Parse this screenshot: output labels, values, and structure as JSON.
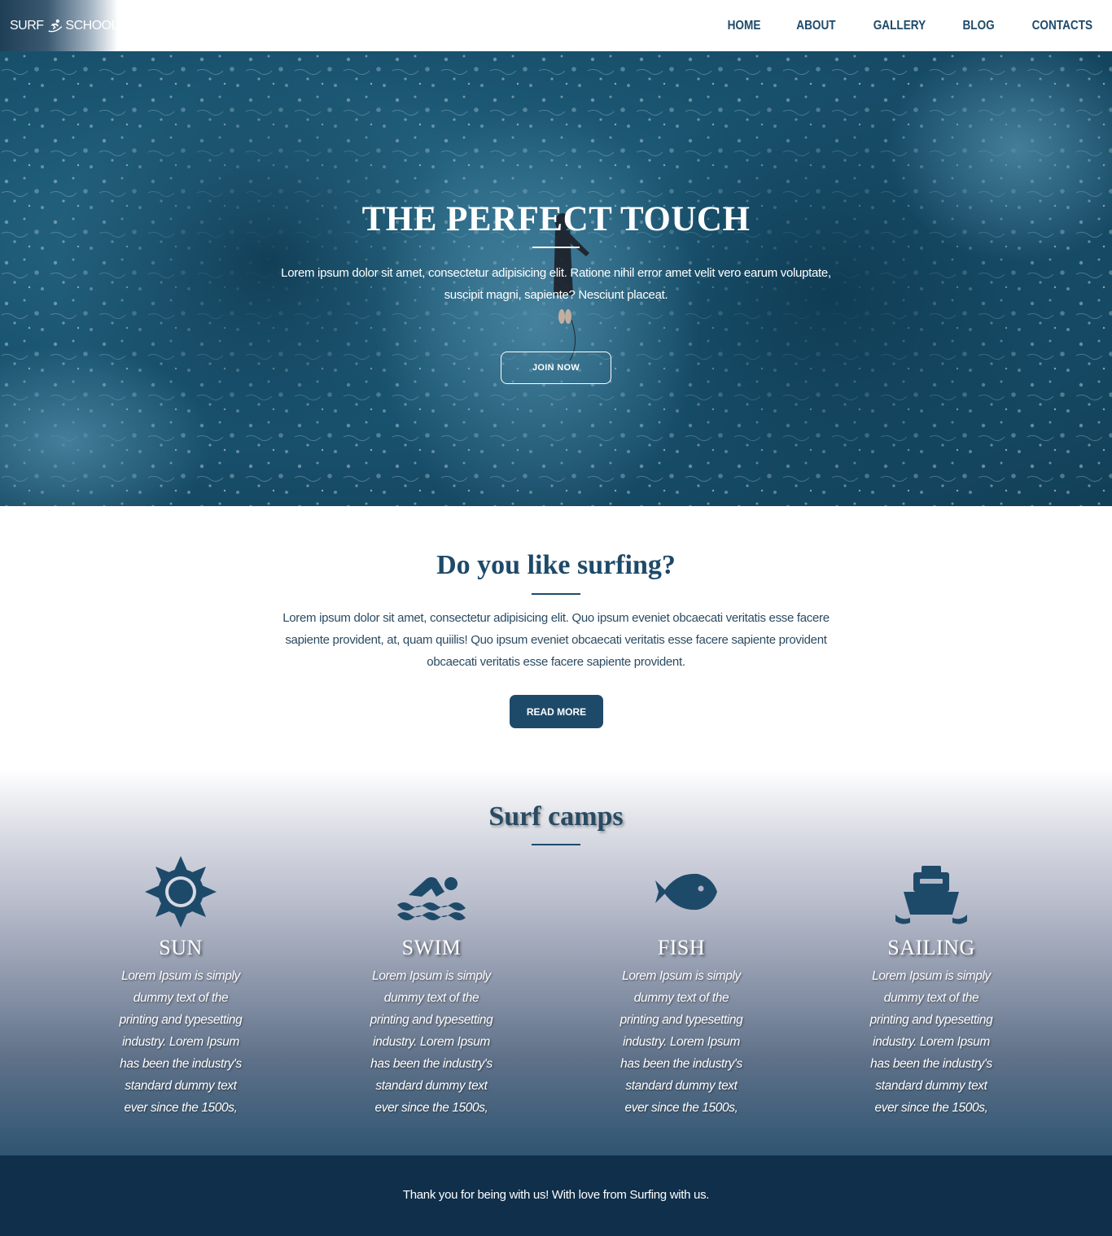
{
  "header": {
    "logo": {
      "left_text": "SURF",
      "right_text": "SCHOOL",
      "icon": "surfer-icon"
    },
    "nav": [
      {
        "label": "HOME"
      },
      {
        "label": "ABOUT"
      },
      {
        "label": "GALLERY"
      },
      {
        "label": "BLOG"
      },
      {
        "label": "CONTACTS"
      }
    ]
  },
  "hero": {
    "title": "THE PERFECT TOUCH",
    "text": "Lorem ipsum dolor sit amet, consectetur adipisicing elit. Ratione nihil error amet velit vero earum voluptate, suscipit magni, sapiente? Nesciunt placeat.",
    "button": "JOIN NOW"
  },
  "about": {
    "title": "Do you like surfing?",
    "text": "Lorem ipsum dolor sit amet, consectetur adipisicing elit. Quo ipsum eveniet obcaecati veritatis esse facere sapiente provident, at, quam quiilis! Quo ipsum eveniet obcaecati veritatis esse facere sapiente provident obcaecati veritatis esse facere sapiente provident.",
    "button": "READ MORE"
  },
  "camps": {
    "title": "Surf camps",
    "items": [
      {
        "name": "SUN",
        "icon": "sun-icon",
        "text": "Lorem Ipsum is simply dummy text of the printing and typesetting industry. Lorem Ipsum has been the industry's standard dummy text ever since the 1500s,"
      },
      {
        "name": "SWIM",
        "icon": "swimmer-icon",
        "text": "Lorem Ipsum is simply dummy text of the printing and typesetting industry. Lorem Ipsum has been the industry's standard dummy text ever since the 1500s,"
      },
      {
        "name": "FISH",
        "icon": "fish-icon",
        "text": "Lorem Ipsum is simply dummy text of the printing and typesetting industry. Lorem Ipsum has been the industry's standard dummy text ever since the 1500s,"
      },
      {
        "name": "SAILING",
        "icon": "ship-icon",
        "text": "Lorem Ipsum is simply dummy text of the printing and typesetting industry. Lorem Ipsum has been the industry's standard dummy text ever since the 1500s,"
      }
    ]
  },
  "footer": {
    "text": "Thank you for being with us! With love from Surfing with us."
  },
  "colors": {
    "primary": "#1e4a6a",
    "footer": "#0f2f4b",
    "hero": "#1a5571"
  }
}
